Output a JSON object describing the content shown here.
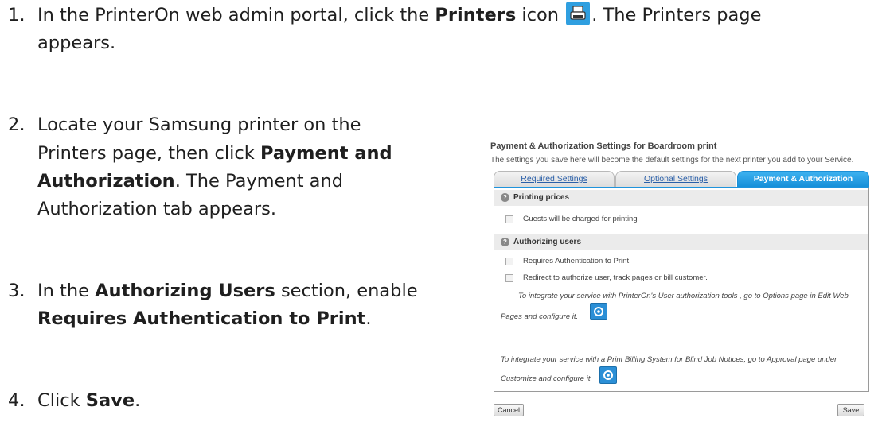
{
  "steps": [
    {
      "num": "1.",
      "lines": [
        {
          "pre": "In the PrinterOn web admin portal, click the ",
          "bold": "Printers",
          "post": " icon"
        },
        {
          "after_icon": ". The Printers page"
        },
        {
          "text": "appears."
        }
      ]
    },
    {
      "num": "2.",
      "line1": "Locate your Samsung printer on the",
      "line2_pre": "Printers page, then click ",
      "line2_bold": "Payment and",
      "line3_bold": "Authorization",
      "line3_post": ". The Payment and",
      "line4": "Authorization tab appears."
    },
    {
      "num": "3.",
      "line1_pre": "In the ",
      "line1_bold": "Authorizing Users",
      "line1_post": " section, enable",
      "line2_bold": "Requires Authentication to Print",
      "line2_post": "."
    },
    {
      "num": "4.",
      "pre": "Click ",
      "bold": "Save",
      "post": "."
    }
  ],
  "icons": {
    "printers": "printer-icon",
    "gear": "gear-icon"
  },
  "panel": {
    "title": "Payment & Authorization Settings for Boardroom print",
    "subtitle": "The settings you save here will become the default settings for the next printer you add to your Service.",
    "tabs": [
      "Required Settings",
      "Optional Settings",
      "Payment & Authorization"
    ],
    "sections": {
      "printing_prices": "Printing prices",
      "guests_charged": "Guests will be charged for printing",
      "authorizing_users": "Authorizing users",
      "requires_auth": "Requires Authentication to Print",
      "redirect": "Redirect to authorize user, track pages or bill customer."
    },
    "note1_a": "To integrate your service with PrinterOn's User authorization tools , go to Options page in Edit Web",
    "note1_b": "Pages and configure it.",
    "note2_a": "To integrate your service with a Print Billing System for Blind Job Notices, go to Approval page under",
    "note2_b": "Customize and configure it.",
    "cancel": "Cancel",
    "save": "Save"
  },
  "colors": {
    "accent": "#1e93dc"
  }
}
